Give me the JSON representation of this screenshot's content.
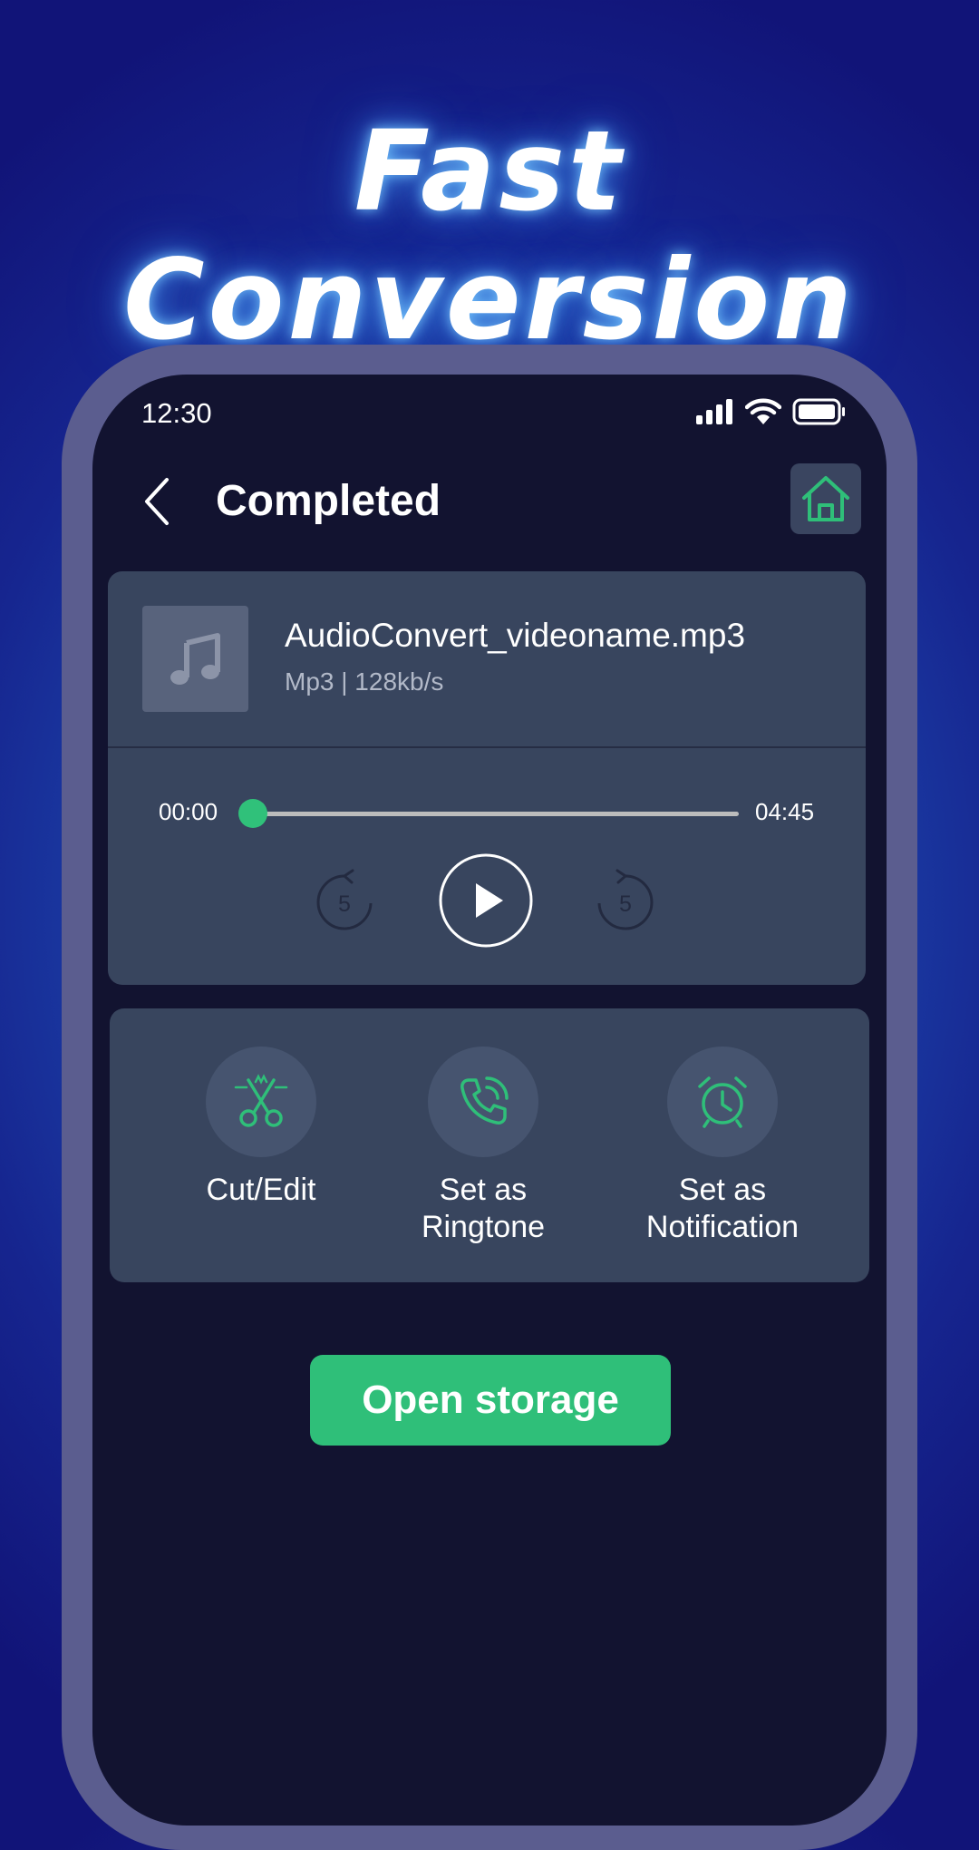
{
  "promo": {
    "headline": "Fast Conversion"
  },
  "status_bar": {
    "time": "12:30",
    "icons": [
      "signal-icon",
      "wifi-icon",
      "battery-icon"
    ]
  },
  "header": {
    "title": "Completed",
    "back_icon": "chevron-left-icon",
    "home_icon": "home-icon"
  },
  "file": {
    "name": "AudioConvert_videoname.mp3",
    "meta": "Mp3 | 128kb/s",
    "thumb_icon": "music-note-icon"
  },
  "player": {
    "current_time": "00:00",
    "total_time": "04:45",
    "progress": 0.0,
    "rewind_label": "5",
    "forward_label": "5"
  },
  "actions": [
    {
      "label": "Cut/Edit",
      "icon": "scissors-icon"
    },
    {
      "label": "Set as Ringtone",
      "label_lines": [
        "Set as",
        "Ringtone"
      ],
      "icon": "phone-ring-icon"
    },
    {
      "label": "Set as Notification",
      "label_lines": [
        "Set as",
        "Notification"
      ],
      "icon": "alarm-clock-icon"
    }
  ],
  "open_storage": {
    "label": "Open storage"
  },
  "colors": {
    "accent": "#2fbf79",
    "background": "#121330",
    "card": "#38455e",
    "frame": "#5b5d8f"
  }
}
